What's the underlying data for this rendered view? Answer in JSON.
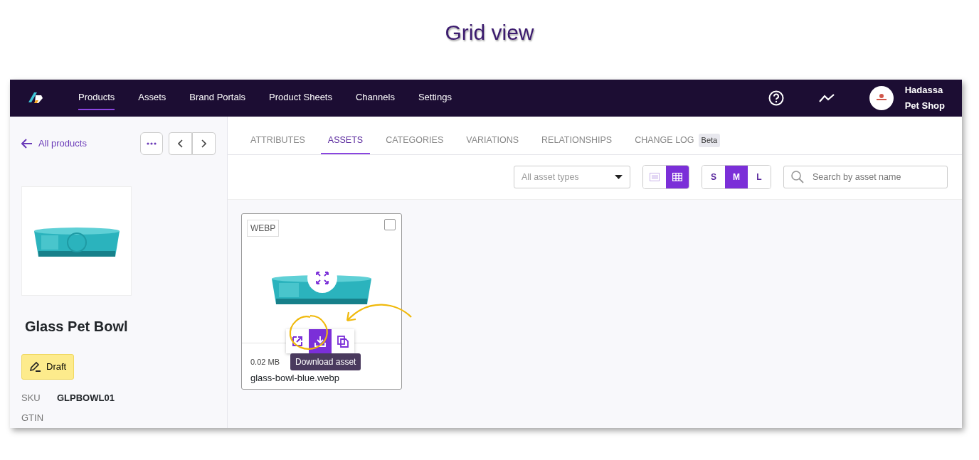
{
  "heading": "Grid view",
  "nav": {
    "items": [
      {
        "label": "Products",
        "selected": true
      },
      {
        "label": "Assets",
        "selected": false
      },
      {
        "label": "Brand Portals",
        "selected": false
      },
      {
        "label": "Product Sheets",
        "selected": false
      },
      {
        "label": "Channels",
        "selected": false
      },
      {
        "label": "Settings",
        "selected": false
      }
    ],
    "account": [
      "Hadassa",
      "Pet Shop"
    ]
  },
  "sidebar": {
    "back_link": "All products",
    "product_name": "Glass Pet Bowl",
    "status": "Draft",
    "fields": [
      {
        "label": "SKU",
        "value": "GLPBOWL01"
      },
      {
        "label": "GTIN"
      }
    ]
  },
  "tabs": [
    {
      "label": "ATTRIBUTES",
      "selected": false
    },
    {
      "label": "ASSETS",
      "selected": true
    },
    {
      "label": "CATEGORIES",
      "selected": false
    },
    {
      "label": "VARIATIONS",
      "selected": false
    },
    {
      "label": "RELATIONSHIPS",
      "selected": false
    },
    {
      "label": "CHANGE LOG",
      "selected": false,
      "badge": "Beta"
    }
  ],
  "toolbar": {
    "type_filter": {
      "placeholder": "All asset types"
    },
    "views": [
      {
        "kind": "list",
        "selected": false
      },
      {
        "kind": "grid",
        "selected": true
      }
    ],
    "sizes": [
      {
        "label": "S",
        "selected": false
      },
      {
        "label": "M",
        "selected": true
      },
      {
        "label": "L",
        "selected": false
      }
    ],
    "search": {
      "placeholder": "Search by asset name"
    }
  },
  "assets": [
    {
      "format": "WEBP",
      "checked": false,
      "file_size": "0.02 MB",
      "file_name": "glass-bowl-blue.webp",
      "actions": [
        {
          "kind": "open",
          "selected": false
        },
        {
          "kind": "download",
          "selected": true
        },
        {
          "kind": "copy",
          "selected": false
        }
      ],
      "tooltip": "Download asset"
    }
  ]
}
